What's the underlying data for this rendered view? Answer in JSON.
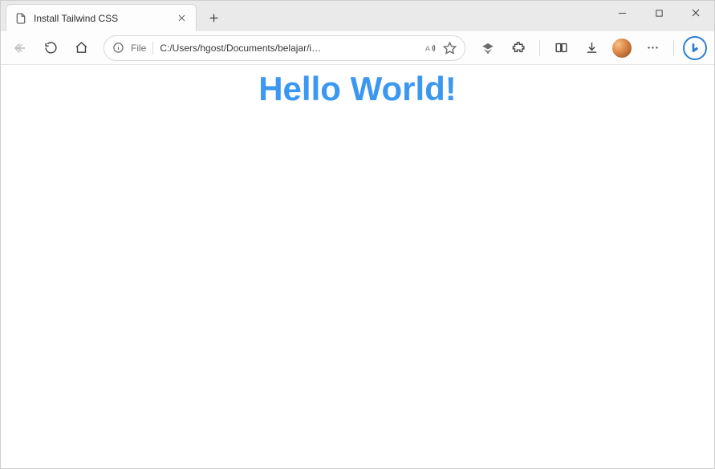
{
  "titlebar": {
    "tab_title": "Install Tailwind CSS"
  },
  "addressbar": {
    "scheme_label": "File",
    "url": "C:/Users/hgost/Documents/belajar/i…"
  },
  "page": {
    "heading": "Hello World!"
  }
}
